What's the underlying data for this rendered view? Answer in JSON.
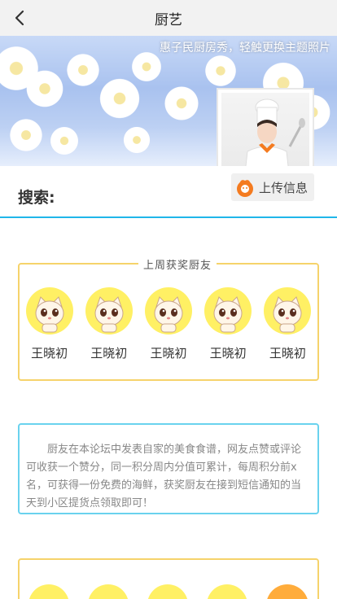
{
  "header": {
    "title": "厨艺"
  },
  "banner": {
    "caption": "惠子民厨房秀，轻触更换主题照片"
  },
  "search": {
    "label": "搜索:"
  },
  "upload": {
    "label": "上传信息"
  },
  "winners": {
    "title": "上周获奖厨友",
    "items": [
      {
        "name": "王晓初"
      },
      {
        "name": "王晓初"
      },
      {
        "name": "王晓初"
      },
      {
        "name": "王晓初"
      },
      {
        "name": "王晓初"
      }
    ]
  },
  "info": {
    "text": "厨友在本论坛中发表自家的美食食谱，网友点赞或评论可收获一个赞分，同一积分周内分值可累计，每周积分前x名，可获得一份免费的海鲜，获奖厨友在接到短信通知的当天到小区提货点领取即可！"
  },
  "colors": {
    "accent_blue": "#1fb6ea",
    "card_yellow": "#f6d36b",
    "card_cyan": "#6ad2ee",
    "kitty_yellow": "#fff064",
    "upload_orange": "#f47b20"
  }
}
